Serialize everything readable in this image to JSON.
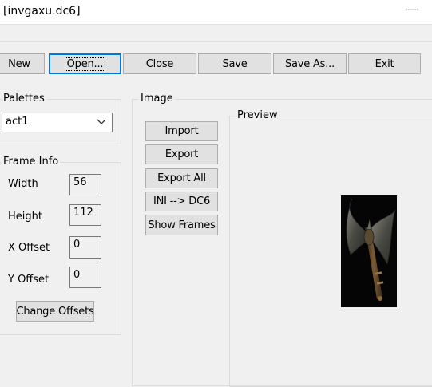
{
  "window": {
    "title": "[invgaxu.dc6]",
    "minimize_glyph": "—"
  },
  "toolbar": {
    "new": "New",
    "open": "Open...",
    "close": "Close",
    "save": "Save",
    "save_as": "Save As...",
    "exit": "Exit"
  },
  "palettes": {
    "label": "Palettes",
    "selected": "act1"
  },
  "frame_info": {
    "label": "Frame Info",
    "width_label": "Width",
    "width_value": "56",
    "height_label": "Height",
    "height_value": "112",
    "xoffset_label": "X Offset",
    "xoffset_value": "0",
    "yoffset_label": "Y Offset",
    "yoffset_value": "0",
    "change_offsets": "Change Offsets"
  },
  "image": {
    "label": "Image",
    "import": "Import",
    "export": "Export",
    "export_all": "Export All",
    "ini_to_dc6": "INI --> DC6",
    "show_frames": "Show Frames"
  },
  "preview": {
    "label": "Preview"
  },
  "icons": {
    "minimize": "minimize-icon",
    "dropdown": "chevron-down-icon",
    "preview_image": "axe-icon"
  },
  "colors": {
    "focus_border": "#0078d7",
    "button_face": "#e1e1e1",
    "window_bg": "#f0f0f0"
  }
}
